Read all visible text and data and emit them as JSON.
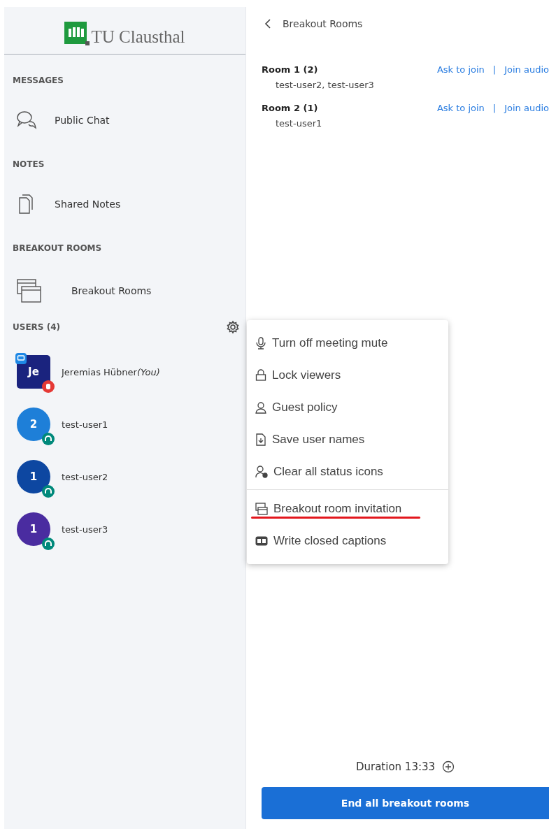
{
  "logo": {
    "text": "TU Clausthal"
  },
  "sections": [
    {
      "heading": "MESSAGES",
      "items": [
        {
          "kind": "chat",
          "label": "Public Chat"
        }
      ]
    },
    {
      "heading": "NOTES",
      "items": [
        {
          "kind": "notes",
          "label": "Shared Notes"
        }
      ]
    },
    {
      "heading": "BREAKOUT ROOMS",
      "items": [
        {
          "kind": "rooms",
          "label": "Breakout Rooms"
        }
      ]
    }
  ],
  "users": {
    "heading": "USERS (4)",
    "list": [
      {
        "initials": "Je",
        "name": "Jeremias Hübner",
        "suffix": "(You)",
        "kind": "square",
        "color": "#1a237e",
        "presenter": true,
        "raised_hand": true
      },
      {
        "initials": "2",
        "name": "test-user1",
        "kind": "circle",
        "color": "#1e7fd8",
        "presenter": false,
        "raised_hand": false
      },
      {
        "initials": "1",
        "name": "test-user2",
        "kind": "circle",
        "color": "#0d47a1",
        "presenter": false,
        "raised_hand": false
      },
      {
        "initials": "1",
        "name": "test-user3",
        "kind": "circle",
        "color": "#4a2ca0",
        "presenter": false,
        "raised_hand": false
      }
    ]
  },
  "panel": {
    "title": "Breakout Rooms",
    "rooms": [
      {
        "name": "Room 1 (2)",
        "members": "test-user2, test-user3",
        "ask": "Ask to join",
        "separator": "|",
        "audio": "Join audio"
      },
      {
        "name": "Room 2 (1)",
        "members": "test-user1",
        "ask": "Ask to join",
        "separator": "|",
        "audio": "Join audio"
      }
    ],
    "duration": "Duration 13:33",
    "end_button": "End all breakout rooms"
  },
  "menu": [
    {
      "kind": "mic",
      "label": "Turn off meeting mute",
      "divider_before": false,
      "highlighted": false
    },
    {
      "kind": "lock",
      "label": "Lock viewers",
      "divider_before": false,
      "highlighted": false
    },
    {
      "kind": "user",
      "label": "Guest policy",
      "divider_before": false,
      "highlighted": false
    },
    {
      "kind": "file",
      "label": "Save user names",
      "divider_before": false,
      "highlighted": false
    },
    {
      "kind": "user-clear",
      "label": "Clear all status icons",
      "divider_before": false,
      "highlighted": false
    },
    {
      "kind": "rooms",
      "label": "Breakout room invitation",
      "divider_before": true,
      "highlighted": true
    },
    {
      "kind": "cc",
      "label": "Write closed captions",
      "divider_before": false,
      "highlighted": false
    }
  ]
}
